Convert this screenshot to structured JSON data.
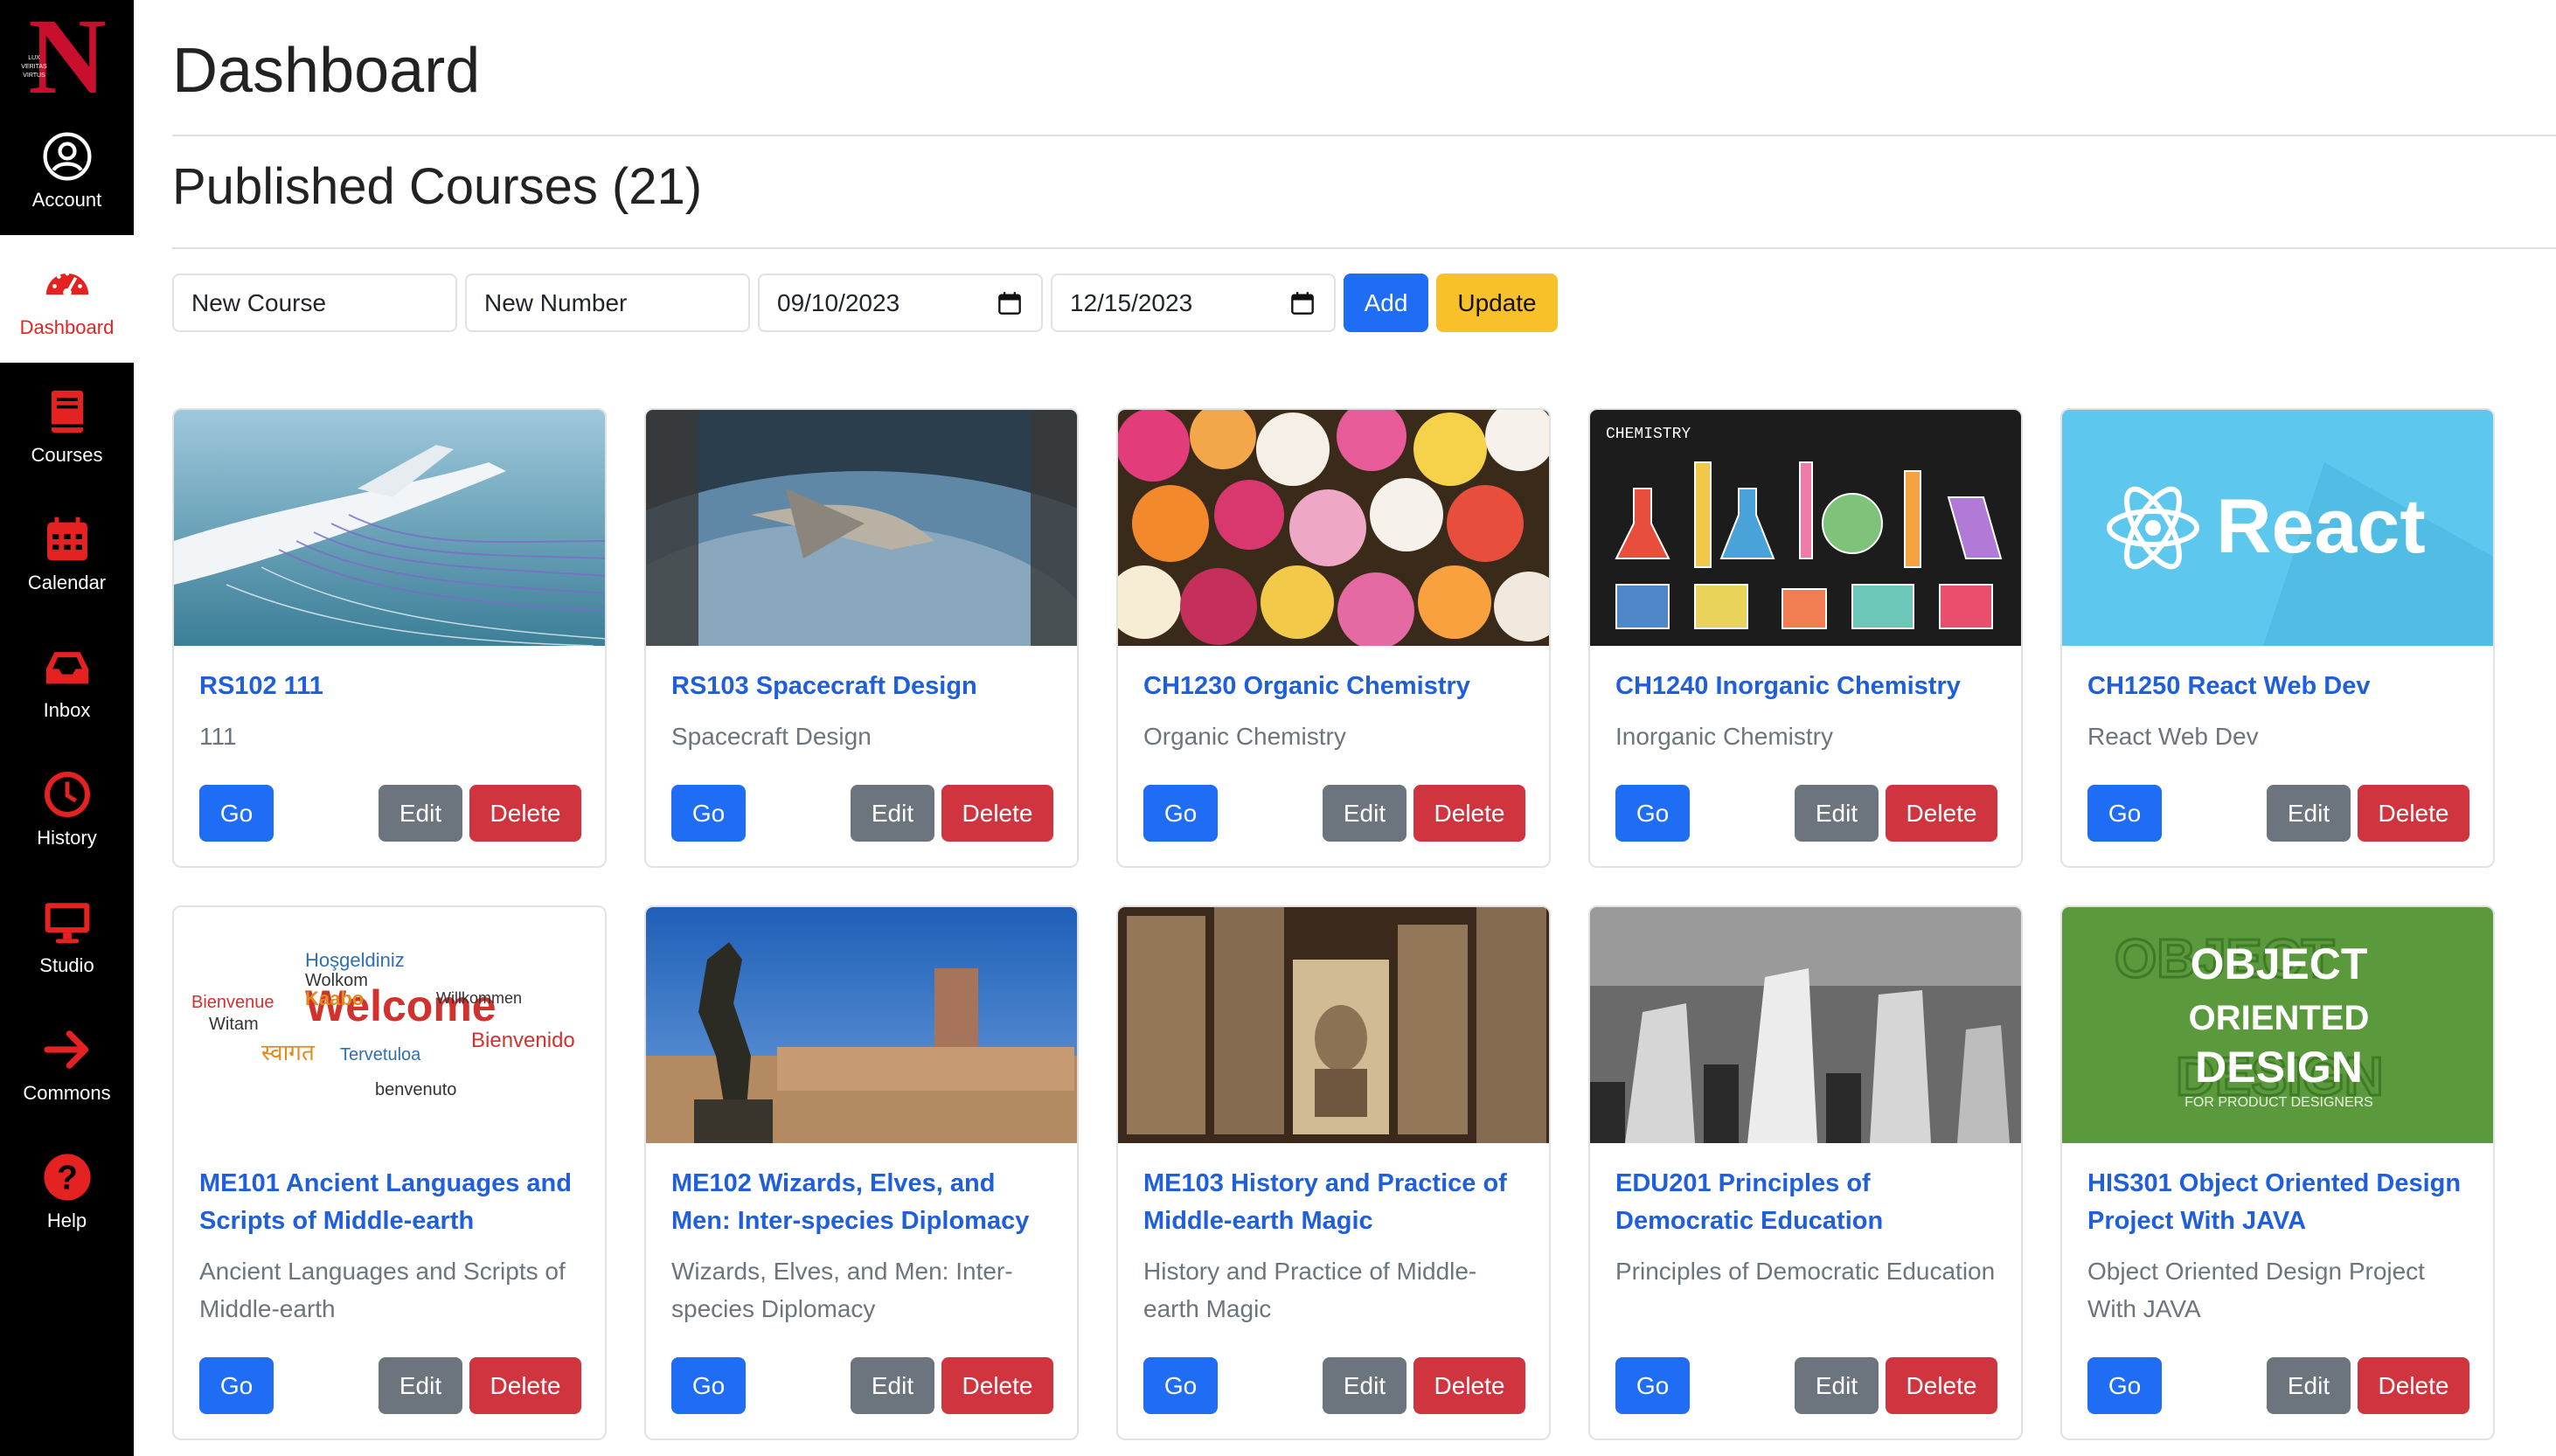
{
  "sidebar": {
    "logo_letter": "N",
    "logo_motto": "LUX VERITAS VIRTUS",
    "items": [
      {
        "label": "Account",
        "icon": "account-circle-icon"
      },
      {
        "label": "Dashboard",
        "icon": "dashboard-gauge-icon"
      },
      {
        "label": "Courses",
        "icon": "book-icon"
      },
      {
        "label": "Calendar",
        "icon": "calendar-icon"
      },
      {
        "label": "Inbox",
        "icon": "inbox-tray-icon"
      },
      {
        "label": "History",
        "icon": "clock-icon"
      },
      {
        "label": "Studio",
        "icon": "monitor-icon"
      },
      {
        "label": "Commons",
        "icon": "arrow-right-icon"
      },
      {
        "label": "Help",
        "icon": "help-circle-icon"
      }
    ],
    "active": "Dashboard"
  },
  "header": {
    "title": "Dashboard",
    "section": "Published Courses (21)"
  },
  "toolbar": {
    "course_name": "New Course",
    "course_number": "New Number",
    "start_date": "09/10/2023",
    "end_date": "12/15/2023",
    "add_label": "Add",
    "update_label": "Update"
  },
  "buttons": {
    "go": "Go",
    "edit": "Edit",
    "delete": "Delete"
  },
  "courses": [
    {
      "title": "RS102 111",
      "subtitle": "111",
      "image": "airplane-wind-tunnel"
    },
    {
      "title": "RS103 Spacecraft Design",
      "subtitle": "Spacecraft Design",
      "image": "spacecraft-over-earth"
    },
    {
      "title": "CH1230 Organic Chemistry",
      "subtitle": "Organic Chemistry",
      "image": "flowers"
    },
    {
      "title": "CH1240 Inorganic Chemistry",
      "subtitle": "Inorganic Chemistry",
      "image": "chemistry-doodles",
      "image_text": "CHEMISTRY"
    },
    {
      "title": "CH1250 React Web Dev",
      "subtitle": "React Web Dev",
      "image": "react-logo",
      "image_text": "React"
    },
    {
      "title": "ME101 Ancient Languages and Scripts of Middle-earth",
      "subtitle": "Ancient Languages and Scripts of Middle-earth",
      "image": "welcome-word-cloud",
      "image_text": "Welcome"
    },
    {
      "title": "ME102 Wizards, Elves, and Men: Inter-species Diplomacy",
      "subtitle": "Wizards, Elves, and Men: Inter-species Diplomacy",
      "image": "roman-statue"
    },
    {
      "title": "ME103 History and Practice of Middle-earth Magic",
      "subtitle": "History and Practice of Middle-earth Magic",
      "image": "old-photographs"
    },
    {
      "title": "EDU201 Principles of Democratic Education",
      "subtitle": "Principles of Democratic Education",
      "image": "raised-fists"
    },
    {
      "title": "HIS301 Object Oriented Design Project With JAVA",
      "subtitle": "Object Oriented Design Project With JAVA",
      "image": "object-oriented-design",
      "image_text": "OBJECT ORIENTED DESIGN",
      "image_subtext": "FOR PRODUCT DESIGNERS"
    }
  ],
  "colors": {
    "accent": "#e52222",
    "primary": "#1f6cf5",
    "warning": "#f8c12a",
    "secondary": "#6c757d",
    "danger": "#d0343f",
    "link": "#1f5fdc"
  }
}
